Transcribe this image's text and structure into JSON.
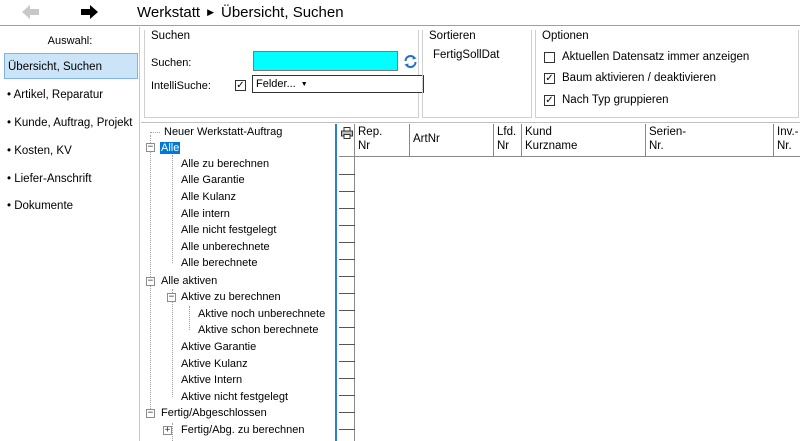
{
  "breadcrumb": {
    "section": "Werkstatt",
    "page": "Übersicht, Suchen"
  },
  "icons": {
    "back": "arrow-left-icon",
    "forward": "arrow-right-icon",
    "refresh": "refresh-icon",
    "printer": "printer-icon"
  },
  "colors": {
    "search_field": "#00ffff",
    "selection": "#0078d7",
    "sidebar_active": "#cce4f7",
    "tree_border": "#2a7fd4"
  },
  "sidebar": {
    "title": "Auswahl:",
    "items": [
      {
        "label": "Übersicht, Suchen",
        "active": true
      },
      {
        "label": "• Artikel, Reparatur"
      },
      {
        "label": "• Kunde, Auftrag, Projekt"
      },
      {
        "label": "• Kosten, KV"
      },
      {
        "label": "• Liefer-Anschrift"
      },
      {
        "label": "• Dokumente"
      }
    ]
  },
  "search": {
    "group_title": "Suchen",
    "search_label": "Suchen:",
    "search_value": "",
    "intelli_label": "IntelliSuche:",
    "intelli_checked": true,
    "fields_dropdown": "Felder..."
  },
  "sort": {
    "group_title": "Sortieren",
    "value": "FertigSollDat"
  },
  "options": {
    "group_title": "Optionen",
    "items": [
      {
        "label": "Aktuellen Datensatz immer anzeigen",
        "checked": false
      },
      {
        "label": "Baum aktivieren / deaktivieren",
        "checked": true
      },
      {
        "label": "Nach Typ gruppieren",
        "checked": true
      }
    ]
  },
  "tree": {
    "items": [
      {
        "label": "Neuer Werkstatt-Auftrag"
      },
      {
        "label": "Alle",
        "selected": true
      },
      {
        "label": "Alle zu berechnen"
      },
      {
        "label": "Alle Garantie"
      },
      {
        "label": "Alle Kulanz"
      },
      {
        "label": "Alle intern"
      },
      {
        "label": "Alle nicht festgelegt"
      },
      {
        "label": "Alle unberechnete"
      },
      {
        "label": "Alle berechnete"
      },
      {
        "label": "Alle aktiven"
      },
      {
        "label": "Aktive zu berechnen"
      },
      {
        "label": "Aktive noch unberechnete"
      },
      {
        "label": "Aktive schon berechnete"
      },
      {
        "label": "Aktive Garantie"
      },
      {
        "label": "Aktive Kulanz"
      },
      {
        "label": "Aktive Intern"
      },
      {
        "label": "Aktive nicht festgelegt"
      },
      {
        "label": "Fertig/Abgeschlossen"
      },
      {
        "label": "Fertig/Abg. zu berechnen"
      }
    ]
  },
  "grid": {
    "columns": [
      {
        "line1": "Rep.",
        "line2": "Nr"
      },
      {
        "line1": "",
        "line2": "ArtNr"
      },
      {
        "line1": "Lfd.",
        "line2": "Nr"
      },
      {
        "line1": "Kund",
        "line2": "Kurzname"
      },
      {
        "line1": "Serien-",
        "line2": "Nr."
      },
      {
        "line1": "Inv.-",
        "line2": "Nr."
      }
    ]
  }
}
